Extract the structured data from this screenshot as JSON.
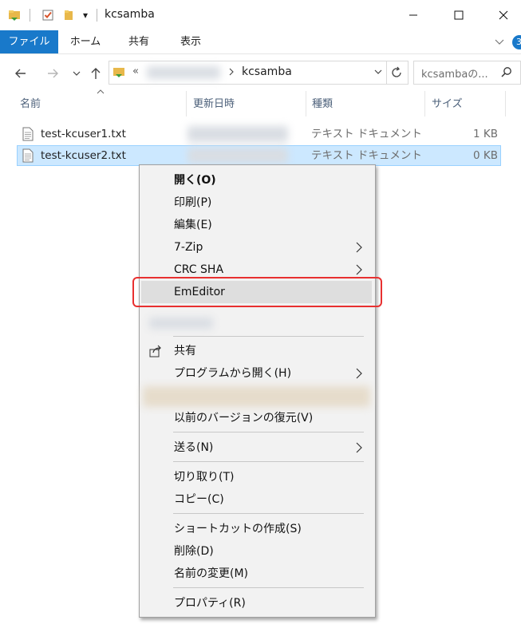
{
  "window": {
    "title": "kcsamba",
    "quick_access_dropdown": "▾"
  },
  "ribbon": {
    "tabs": [
      "ファイル",
      "ホーム",
      "共有",
      "表示"
    ],
    "help_badge": "3"
  },
  "address": {
    "chevron": "«",
    "current_folder": "kcsamba",
    "search_placeholder": "kcsambaの..."
  },
  "columns": {
    "name": "名前",
    "date": "更新日時",
    "type": "種類",
    "size": "サイズ"
  },
  "files": [
    {
      "name": "test-kcuser1.txt",
      "type": "テキスト ドキュメント",
      "size": "1 KB",
      "selected": false
    },
    {
      "name": "test-kcuser2.txt",
      "type": "テキスト ドキュメント",
      "size": "0 KB",
      "selected": true
    }
  ],
  "context_menu": {
    "items": {
      "open": "開く(O)",
      "print": "印刷(P)",
      "edit": "編集(E)",
      "sevenzip": "7-Zip",
      "crcsha": "CRC SHA",
      "emeditor": "EmEditor",
      "share": "共有",
      "open_with": "プログラムから開く(H)",
      "restore": "以前のバージョンの復元(V)",
      "send_to": "送る(N)",
      "cut": "切り取り(T)",
      "copy": "コピー(C)",
      "shortcut": "ショートカットの作成(S)",
      "delete": "削除(D)",
      "rename": "名前の変更(M)",
      "properties": "プロパティ(R)"
    },
    "highlighted_item": "EmEditor",
    "highlight_color": "#e83030"
  },
  "colors": {
    "accent": "#1979ca",
    "selection": "#cce8ff",
    "menu_bg": "#f2f2f2"
  }
}
